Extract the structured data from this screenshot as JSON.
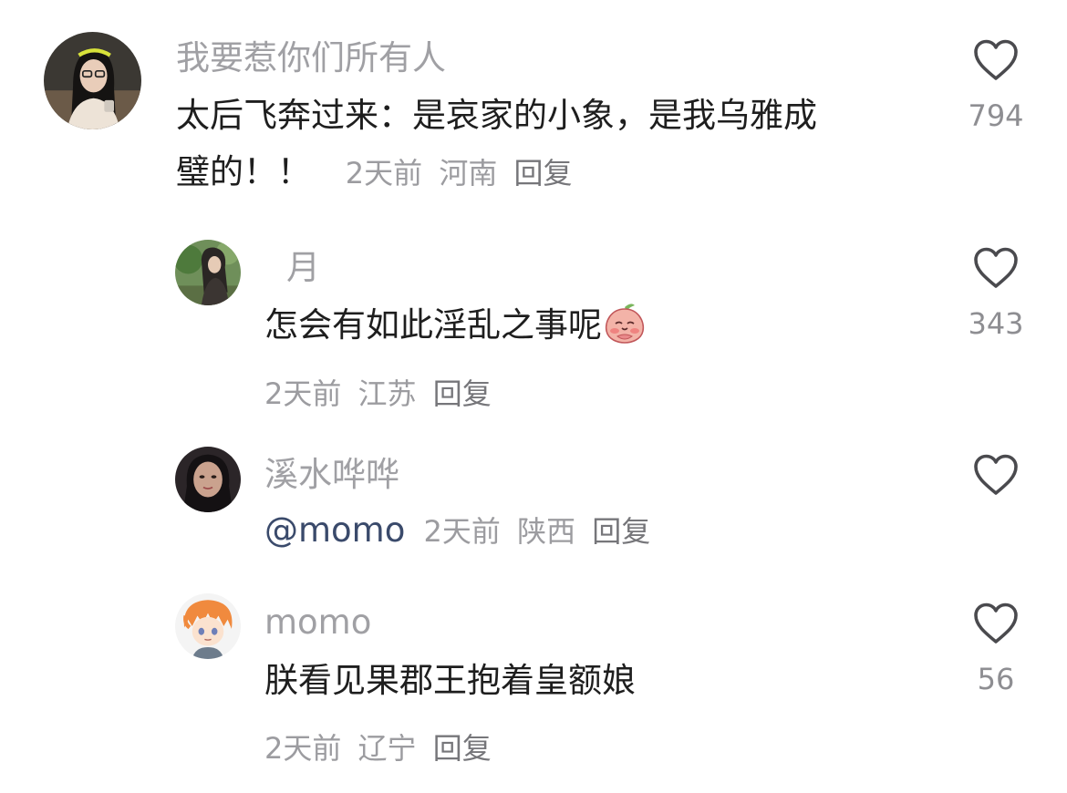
{
  "comments": [
    {
      "username": "我要惹你们所有人",
      "text_line1": "太后飞奔过来：是哀家的小象，是我乌雅成",
      "text_line2": "璧的！！",
      "time": "2天前",
      "location": "河南",
      "reply_label": "回复",
      "likes": "794",
      "avatar_icon": "avatar-woman-glasses"
    },
    {
      "username": "月",
      "text": "怎会有如此淫乱之事呢",
      "emoji_icon": "peach-embarrassed-emoji",
      "time": "2天前",
      "location": "江苏",
      "reply_label": "回复",
      "likes": "343",
      "avatar_icon": "avatar-woman-outdoor"
    },
    {
      "username": "溪水哗哗",
      "mention": "@momo",
      "time": "2天前",
      "location": "陕西",
      "reply_label": "回复",
      "avatar_icon": "avatar-woman-portrait"
    },
    {
      "username": "momo",
      "text": "朕看见果郡王抱着皇额娘",
      "time": "2天前",
      "location": "辽宁",
      "reply_label": "回复",
      "likes": "56",
      "avatar_icon": "avatar-anime-boy"
    }
  ],
  "colors": {
    "username": "#a0a0a4",
    "content": "#1e1e1e",
    "meta": "#9c9ca0",
    "mention": "#3a4a6b",
    "heart_outline": "#4a4a4e"
  }
}
